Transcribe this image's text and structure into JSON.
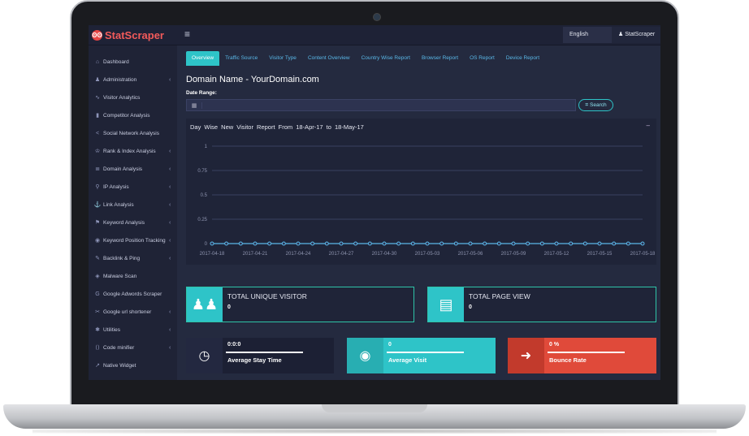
{
  "brand": {
    "name": "StatScraper",
    "logo_glyph": "ʘʘ"
  },
  "topbar": {
    "menu_icon": "hamburger-icon",
    "language": "English",
    "username": "StatScraper"
  },
  "sidebar": {
    "items": [
      {
        "label": "Dashboard",
        "icon": "dashboard-icon",
        "glyph": "⌂",
        "has_children": false
      },
      {
        "label": "Administration",
        "icon": "users-icon",
        "glyph": "♟",
        "has_children": true
      },
      {
        "label": "Visitor Analytics",
        "icon": "line-chart-icon",
        "glyph": "∿",
        "has_children": false
      },
      {
        "label": "Competitor Analysis",
        "icon": "bar-chart-icon",
        "glyph": "▮",
        "has_children": false
      },
      {
        "label": "Social Network Analysis",
        "icon": "share-icon",
        "glyph": "<",
        "has_children": false
      },
      {
        "label": "Rank & Index Analysis",
        "icon": "trophy-icon",
        "glyph": "♔",
        "has_children": true
      },
      {
        "label": "Domain Analysis",
        "icon": "server-icon",
        "glyph": "≣",
        "has_children": true
      },
      {
        "label": "IP Analysis",
        "icon": "map-marker-icon",
        "glyph": "⚲",
        "has_children": true
      },
      {
        "label": "Link Analysis",
        "icon": "anchor-icon",
        "glyph": "⚓",
        "has_children": true
      },
      {
        "label": "Keyword Analysis",
        "icon": "tags-icon",
        "glyph": "⚑",
        "has_children": true
      },
      {
        "label": "Keyword Position Tracking",
        "icon": "eye-icon",
        "glyph": "◉",
        "has_children": true
      },
      {
        "label": "Backlink & Ping",
        "icon": "pencil-icon",
        "glyph": "✎",
        "has_children": true
      },
      {
        "label": "Malware Scan",
        "icon": "shield-icon",
        "glyph": "◈",
        "has_children": false
      },
      {
        "label": "Google Adwords Scraper",
        "icon": "google-icon",
        "glyph": "G",
        "has_children": false
      },
      {
        "label": "Google url shortener",
        "icon": "scissors-icon",
        "glyph": "✂",
        "has_children": true
      },
      {
        "label": "Utilities",
        "icon": "asterisk-icon",
        "glyph": "✱",
        "has_children": true
      },
      {
        "label": "Code minifier",
        "icon": "code-icon",
        "glyph": "⟨⟩",
        "has_children": true
      },
      {
        "label": "Native Widget",
        "icon": "external-link-icon",
        "glyph": "↗",
        "has_children": false
      }
    ]
  },
  "tabs": [
    "Overview",
    "Traffic Source",
    "Visitor Type",
    "Content Overview",
    "Country Wise Report",
    "Browser Report",
    "OS Report",
    "Device Report"
  ],
  "active_tab": "Overview",
  "page_title": "Domain Name - YourDomain.com",
  "date_range": {
    "label": "Date Range:",
    "value": "",
    "placeholder": ""
  },
  "search_button": {
    "label": "Search",
    "icon": "binoculars-icon"
  },
  "chart_card": {
    "title": "Day Wise New Visitor Report From 18-Apr-17 to 18-May-17",
    "collapse_glyph": "–"
  },
  "chart_data": {
    "type": "line",
    "x": [
      "2017-04-18",
      "2017-04-19",
      "2017-04-20",
      "2017-04-21",
      "2017-04-22",
      "2017-04-23",
      "2017-04-24",
      "2017-04-25",
      "2017-04-26",
      "2017-04-27",
      "2017-04-28",
      "2017-04-29",
      "2017-04-30",
      "2017-05-01",
      "2017-05-02",
      "2017-05-03",
      "2017-05-04",
      "2017-05-05",
      "2017-05-06",
      "2017-05-07",
      "2017-05-08",
      "2017-05-09",
      "2017-05-10",
      "2017-05-11",
      "2017-05-12",
      "2017-05-13",
      "2017-05-14",
      "2017-05-15",
      "2017-05-16",
      "2017-05-17",
      "2017-05-18"
    ],
    "series": [
      {
        "values": [
          0,
          0,
          0,
          0,
          0,
          0,
          0,
          0,
          0,
          0,
          0,
          0,
          0,
          0,
          0,
          0,
          0,
          0,
          0,
          0,
          0,
          0,
          0,
          0,
          0,
          0,
          0,
          0,
          0,
          0,
          0
        ]
      }
    ],
    "x_tick_labels": [
      "2017-04-18",
      "2017-04-21",
      "2017-04-24",
      "2017-04-27",
      "2017-04-30",
      "2017-05-03",
      "2017-05-06",
      "2017-05-09",
      "2017-05-12",
      "2017-05-15",
      "2017-05-18"
    ],
    "y_ticks": [
      "0",
      "0.25",
      "0.5",
      "0.75",
      "1"
    ],
    "ylim": [
      0,
      1
    ],
    "grid": true,
    "color": "#5ab8e8"
  },
  "stats": {
    "unique_visitor": {
      "label": "TOTAL UNIQUE VISITOR",
      "value": "0",
      "icon": "users-icon"
    },
    "page_view": {
      "label": "TOTAL PAGE VIEW",
      "value": "0",
      "icon": "file-text-icon"
    }
  },
  "mini_stats": {
    "stay_time": {
      "label": "Average Stay Time",
      "value": "0:0:0",
      "icon": "clock-icon",
      "color": "#232840"
    },
    "avg_visit": {
      "label": "Average Visit",
      "value": "0",
      "icon": "eye-icon",
      "color": "#2ec4c8"
    },
    "bounce": {
      "label": "Bounce Rate",
      "value": "0 %",
      "icon": "sign-out-icon",
      "color": "#e04a3a"
    }
  }
}
